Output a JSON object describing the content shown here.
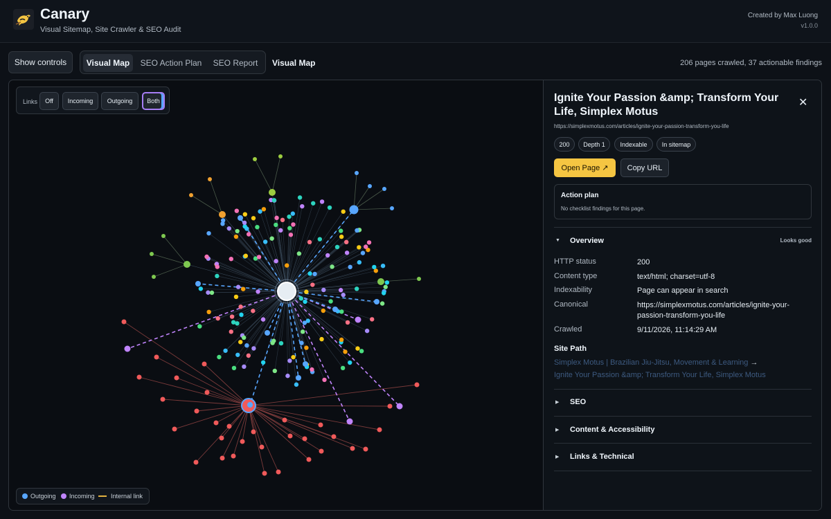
{
  "header": {
    "title": "Canary",
    "subtitle": "Visual Sitemap, Site Crawler & SEO Audit",
    "created_by": "Created by Max Luong",
    "version": "v1.0.0"
  },
  "toolbar": {
    "show_controls": "Show controls",
    "tabs": [
      {
        "label": "Visual Map",
        "active": true
      },
      {
        "label": "SEO Action Plan",
        "active": false
      },
      {
        "label": "SEO Report",
        "active": false
      }
    ],
    "view_title": "Visual Map",
    "stats": "206 pages crawled, 37 actionable findings"
  },
  "map": {
    "links_label": "Links",
    "link_modes": [
      "Off",
      "Incoming",
      "Outgoing",
      "Both"
    ],
    "active_mode": "Both",
    "legend": {
      "outgoing": "Outgoing",
      "incoming": "Incoming",
      "internal": "Internal link"
    },
    "colors": {
      "outgoing": "#58a6ff",
      "incoming": "#c084fc",
      "internal": "#e3b341",
      "red_cluster": "#f05a5a",
      "green_cluster": "#7ec850",
      "orange_cluster": "#f0a030"
    }
  },
  "detail": {
    "title": "Ignite Your Passion &amp; Transform Your Life, Simplex Motus",
    "url": "https://simplexmotus.com/articles/ignite-your-passion-transform-you-life",
    "badges": [
      "200",
      "Depth 1",
      "Indexable",
      "In sitemap"
    ],
    "open_page": "Open Page ↗",
    "copy_url": "Copy URL",
    "action_plan": {
      "title": "Action plan",
      "text": "No checklist findings for this page."
    },
    "overview": {
      "label": "Overview",
      "status": "Looks good",
      "rows": [
        {
          "label": "HTTP status",
          "value": "200"
        },
        {
          "label": "Content type",
          "value": "text/html; charset=utf-8"
        },
        {
          "label": "Indexability",
          "value": "Page can appear in search"
        },
        {
          "label": "Canonical",
          "value": "https://simplexmotus.com/articles/ignite-your-passion-transform-you-life"
        },
        {
          "label": "Crawled",
          "value": "9/11/2026, 11:14:29 AM"
        }
      ]
    },
    "site_path": {
      "title": "Site Path",
      "items": [
        "Simplex Motus | Brazilian Jiu-Jitsu, Movement & Learning",
        "Ignite Your Passion &amp; Transform Your Life, Simplex Motus"
      ],
      "separator": "→"
    },
    "sections": [
      "SEO",
      "Content & Accessibility",
      "Links & Technical"
    ]
  }
}
